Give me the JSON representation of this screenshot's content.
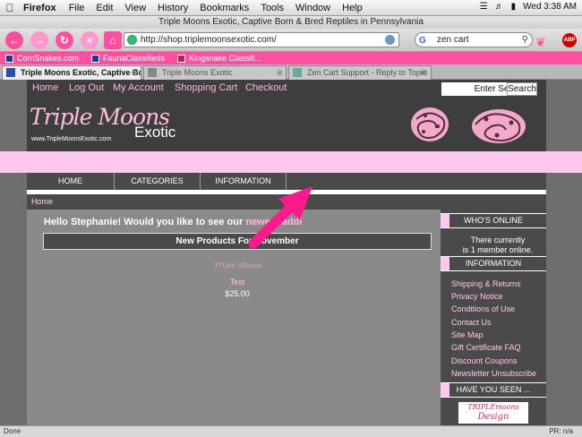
{
  "menubar": {
    "app": "Firefox",
    "items": [
      "File",
      "Edit",
      "View",
      "History",
      "Bookmarks",
      "Tools",
      "Window",
      "Help"
    ],
    "clock": "Wed 3:38 AM"
  },
  "window_title": "Triple Moons Exotic, Captive Born & Bred Reptiles in Pennsylvania",
  "toolbar": {
    "url": "http://shop.triplemoonsexotic.com/",
    "search_query": "zen cart",
    "search_engine_letter": "G"
  },
  "bookmarks": [
    "CornSnakes.com",
    "FaunaClassifieds",
    "Kingsnake Classifi..."
  ],
  "tabs": [
    {
      "label": "Triple Moons Exotic, Captive Born...",
      "active": true
    },
    {
      "label": "Triple Moons Exotic",
      "active": false
    },
    {
      "label": "Zen Cart Support - Reply to Topic",
      "active": false
    }
  ],
  "site": {
    "topnav": [
      "Home",
      "Log Out",
      "My Account",
      "Shopping Cart",
      "Checkout"
    ],
    "search_placeholder": "Enter Search",
    "search_button": "Search",
    "logo_script": "Triple Moons",
    "logo_sub": "Exotic",
    "logo_url": "www.TripleMoonsExotic.com",
    "catnav": [
      "HOME",
      "CATEGORIES",
      "INFORMATION"
    ],
    "breadcrumb": "Home",
    "greeting_prefix": "Hello Stephanie! Would you like to see our",
    "greeting_link": "newest addi",
    "new_products": "New Products For November",
    "product": {
      "name": "Test",
      "price": "$25.00"
    }
  },
  "sidebar": {
    "whos_online_title": "WHO'S ONLINE",
    "whos_online_text_1": "There currently",
    "whos_online_text_2": "is 1 member online.",
    "information_title": "INFORMATION",
    "links": [
      "Shipping & Returns",
      "Privacy Notice",
      "Conditions of Use",
      "Contact Us",
      "Site Map",
      "Gift Certificate FAQ",
      "Discount Coupons",
      "Newsletter Unsubscribe"
    ],
    "have_you_seen_title": "HAVE YOU SEEN ...",
    "badge_line1": "TRIPLEmoons",
    "badge_line2": "Design"
  },
  "statusbar": {
    "left": "Done",
    "right": "PR: n/a"
  },
  "colors": {
    "pink": "#ffc8ec",
    "dark": "#3e3e3e",
    "arrow": "#ff1a8c"
  }
}
